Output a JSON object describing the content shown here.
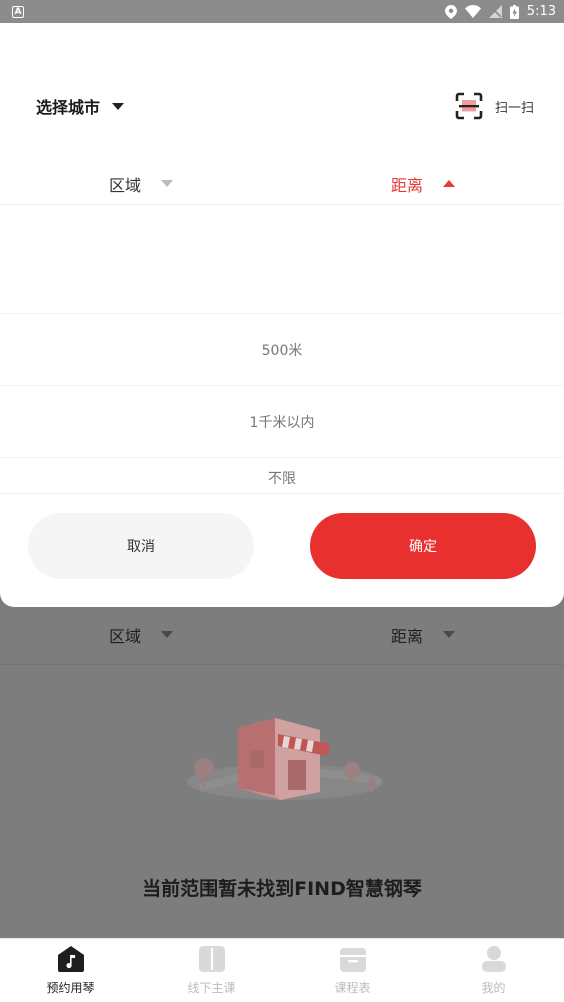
{
  "status_bar": {
    "time": "5:13",
    "notification_letter": "A"
  },
  "sheet": {
    "city_label": "选择城市",
    "scan_label": "扫一扫",
    "filter": {
      "region_label": "区域",
      "distance_label": "距离"
    },
    "options": [
      "500米",
      "1千米以内",
      "不限"
    ],
    "cancel_label": "取消",
    "confirm_label": "确定"
  },
  "background": {
    "filter": {
      "region_label": "区域",
      "distance_label": "距离"
    },
    "empty_message": "当前范围暂未找到FIND智慧钢琴"
  },
  "tabs": [
    {
      "label": "预约用琴",
      "icon": "house-music-icon",
      "active": true
    },
    {
      "label": "线下主课",
      "icon": "book-icon",
      "active": false
    },
    {
      "label": "课程表",
      "icon": "calendar-icon",
      "active": false
    },
    {
      "label": "我的",
      "icon": "person-icon",
      "active": false
    }
  ],
  "colors": {
    "accent": "#e8302f",
    "active_text": "#e53935"
  }
}
